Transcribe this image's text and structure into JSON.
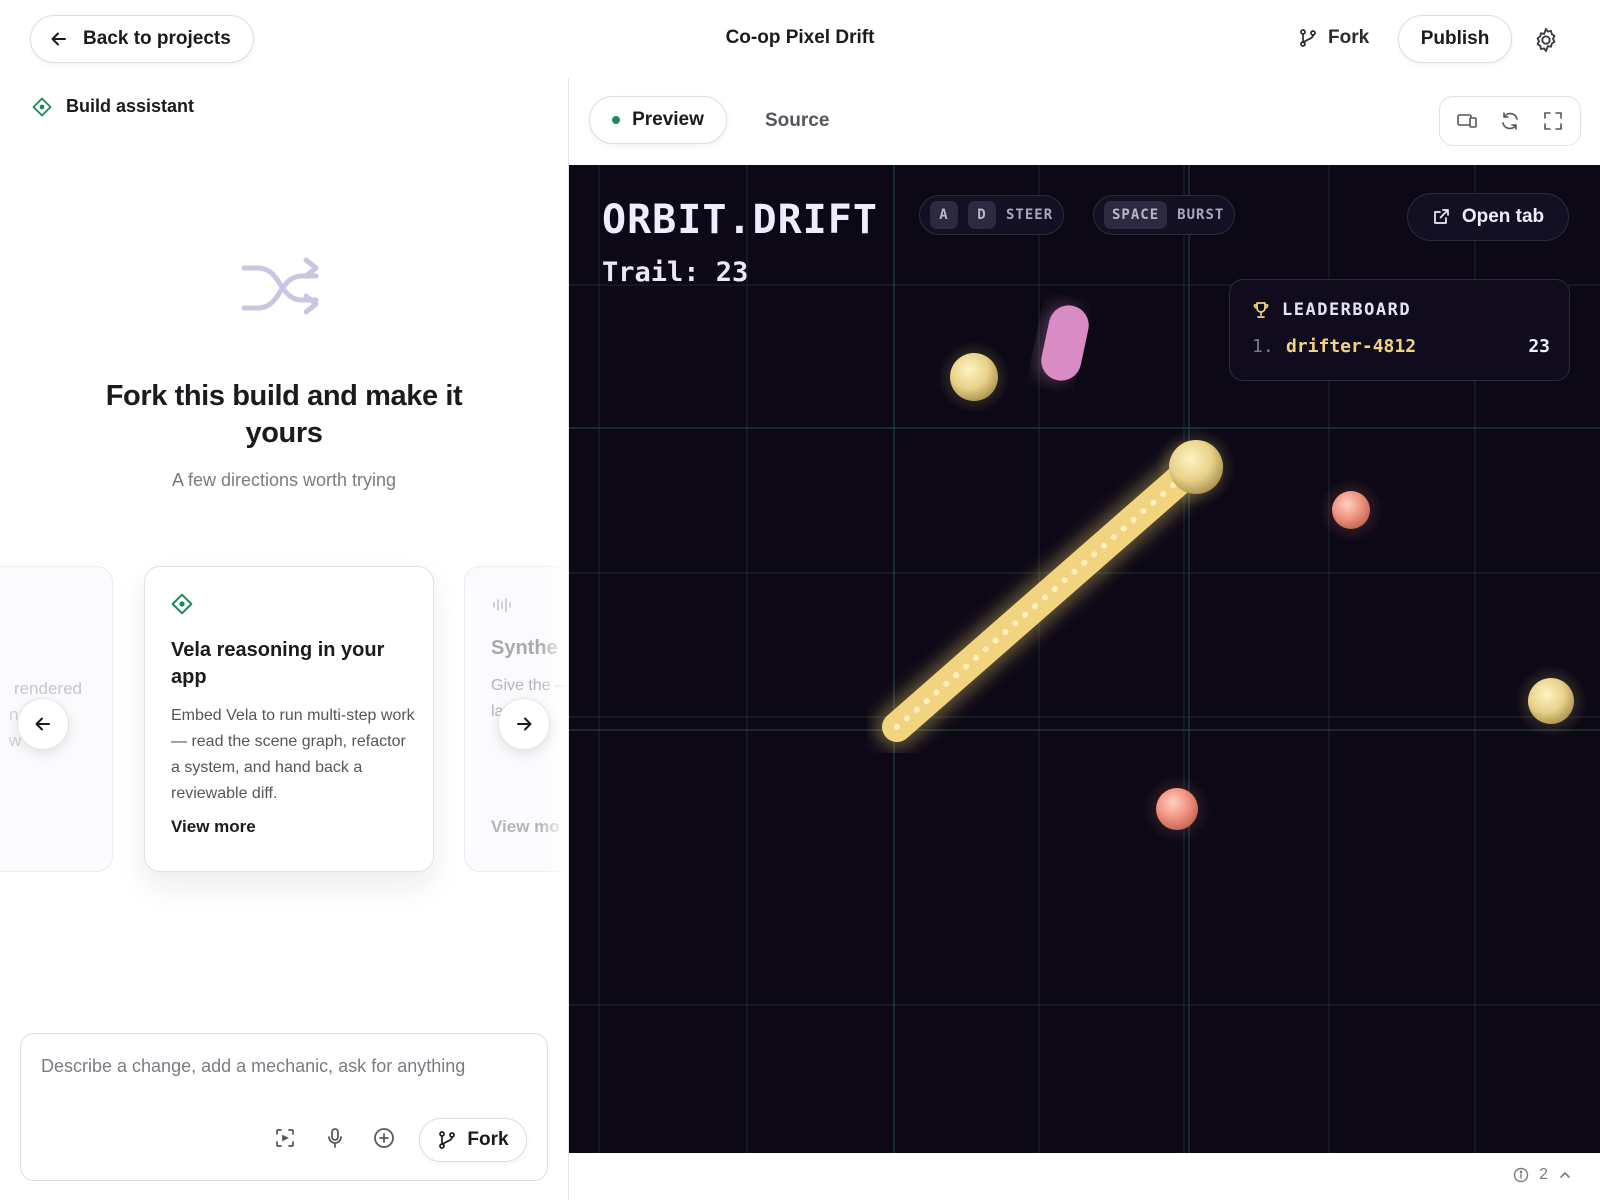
{
  "header": {
    "back_label": "Back to projects",
    "title": "Co-op Pixel Drift",
    "fork_label": "Fork",
    "publish_label": "Publish"
  },
  "assistant": {
    "title": "Build assistant",
    "heading": "Fork this build and make it yours",
    "subheading": "A few directions worth trying",
    "cards": [
      {
        "partial_text": "rendered",
        "partial_lines": [
          "n",
          "w"
        ]
      },
      {
        "icon": "vela-diamond-icon",
        "title": "Vela reasoning in your app",
        "description": "Embed Vela to run multi-step work — read the scene graph, refactor a system, and hand back a reviewable diff.",
        "link": "View more"
      },
      {
        "icon": "waveform-icon",
        "title": "Synthe",
        "description": "Give the — lea lap.",
        "link": "View mo"
      }
    ],
    "composer": {
      "placeholder": "Describe a change, add a mechanic, ask for anything",
      "fork_label": "Fork"
    }
  },
  "preview": {
    "tabs": {
      "preview": "Preview",
      "source": "Source"
    },
    "active_tab": "preview"
  },
  "game": {
    "title": "ORBIT.DRIFT",
    "trail_label": "Trail: 23",
    "steer_keys": [
      "A",
      "D"
    ],
    "steer_label": "STEER",
    "burst_key": "SPACE",
    "burst_label": "BURST",
    "open_tab_label": "Open tab",
    "leaderboard": {
      "title": "LEADERBOARD",
      "rows": [
        {
          "rank": "1.",
          "name": "drifter-4812",
          "score": "23"
        }
      ]
    }
  },
  "status": {
    "count": "2"
  },
  "colors": {
    "accent_green": "#1d8a5c",
    "game_bg": "#0c0816",
    "trail_gold": "#f2d37f",
    "orb_coral": "#f0907e",
    "pill_pink": "#d98bc3"
  }
}
